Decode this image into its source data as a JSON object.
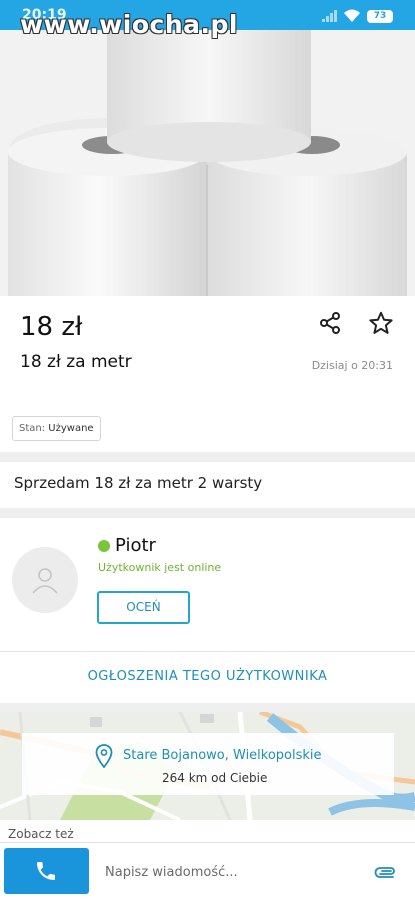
{
  "status_bar": {
    "time": "20:19",
    "battery": "73",
    "watermark": "www.wiocha.pl"
  },
  "listing": {
    "price": "18 zł",
    "title": "18 zł za metr",
    "date": "Dzisiaj o 20:31",
    "condition_label": "Stan:",
    "condition_value": "Używane",
    "description": "Sprzedam 18 zł za metr 2 warsty"
  },
  "seller": {
    "name": "Piotr",
    "status": "Użytkownik jest online",
    "rate_label": "OCEŃ",
    "ads_link": "OGŁOSZENIA TEGO UŻYTKOWNIKA"
  },
  "map": {
    "location": "Stare Bojanowo, Wielkopolskie",
    "distance": "264 km od Ciebie"
  },
  "see_also": "Zobacz też",
  "bottom_bar": {
    "message_placeholder": "Napisz wiadomość..."
  },
  "colors": {
    "accent": "#23a6e3",
    "link": "#1e8fb5",
    "online": "#7cc43a",
    "call_button": "#1a95db"
  }
}
